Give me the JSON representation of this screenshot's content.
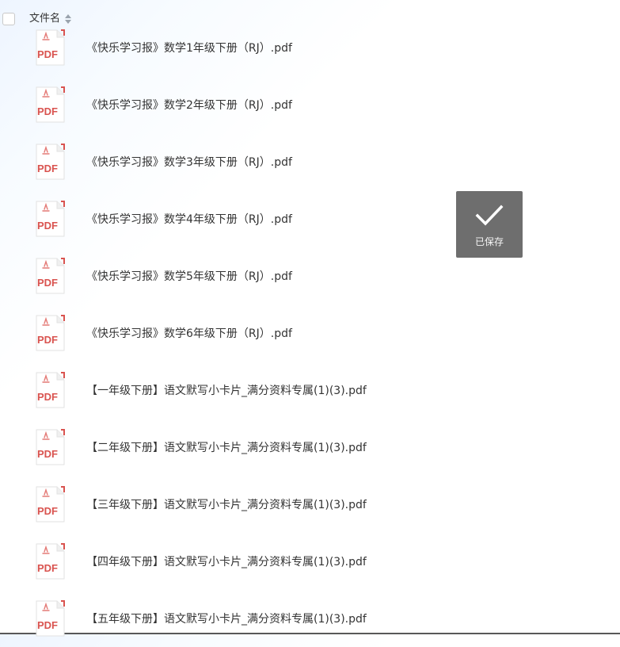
{
  "header": {
    "column_name": "文件名"
  },
  "files": [
    {
      "name": "《快乐学习报》数学1年级下册（RJ）.pdf",
      "type_label": "PDF",
      "icon": "pdf-file-icon"
    },
    {
      "name": "《快乐学习报》数学2年级下册（RJ）.pdf",
      "type_label": "PDF",
      "icon": "pdf-file-icon"
    },
    {
      "name": "《快乐学习报》数学3年级下册（RJ）.pdf",
      "type_label": "PDF",
      "icon": "pdf-file-icon"
    },
    {
      "name": "《快乐学习报》数学4年级下册（RJ）.pdf",
      "type_label": "PDF",
      "icon": "pdf-file-icon"
    },
    {
      "name": "《快乐学习报》数学5年级下册（RJ）.pdf",
      "type_label": "PDF",
      "icon": "pdf-file-icon"
    },
    {
      "name": "《快乐学习报》数学6年级下册（RJ）.pdf",
      "type_label": "PDF",
      "icon": "pdf-file-icon"
    },
    {
      "name": "【一年级下册】语文默写小卡片_满分资料专属(1)(3).pdf",
      "type_label": "PDF",
      "icon": "pdf-file-icon"
    },
    {
      "name": "【二年级下册】语文默写小卡片_满分资料专属(1)(3).pdf",
      "type_label": "PDF",
      "icon": "pdf-file-icon"
    },
    {
      "name": "【三年级下册】语文默写小卡片_满分资料专属(1)(3).pdf",
      "type_label": "PDF",
      "icon": "pdf-file-icon"
    },
    {
      "name": "【四年级下册】语文默写小卡片_满分资料专属(1)(3).pdf",
      "type_label": "PDF",
      "icon": "pdf-file-icon"
    },
    {
      "name": "【五年级下册】语文默写小卡片_满分资料专属(1)(3).pdf",
      "type_label": "PDF",
      "icon": "pdf-file-icon"
    }
  ],
  "toast": {
    "text": "已保存",
    "icon": "checkmark-icon"
  },
  "colors": {
    "pdf_red": "#d9534f",
    "pdf_border": "#e3e3e3",
    "text": "#333333",
    "toast_bg": "#5a5a5a"
  }
}
